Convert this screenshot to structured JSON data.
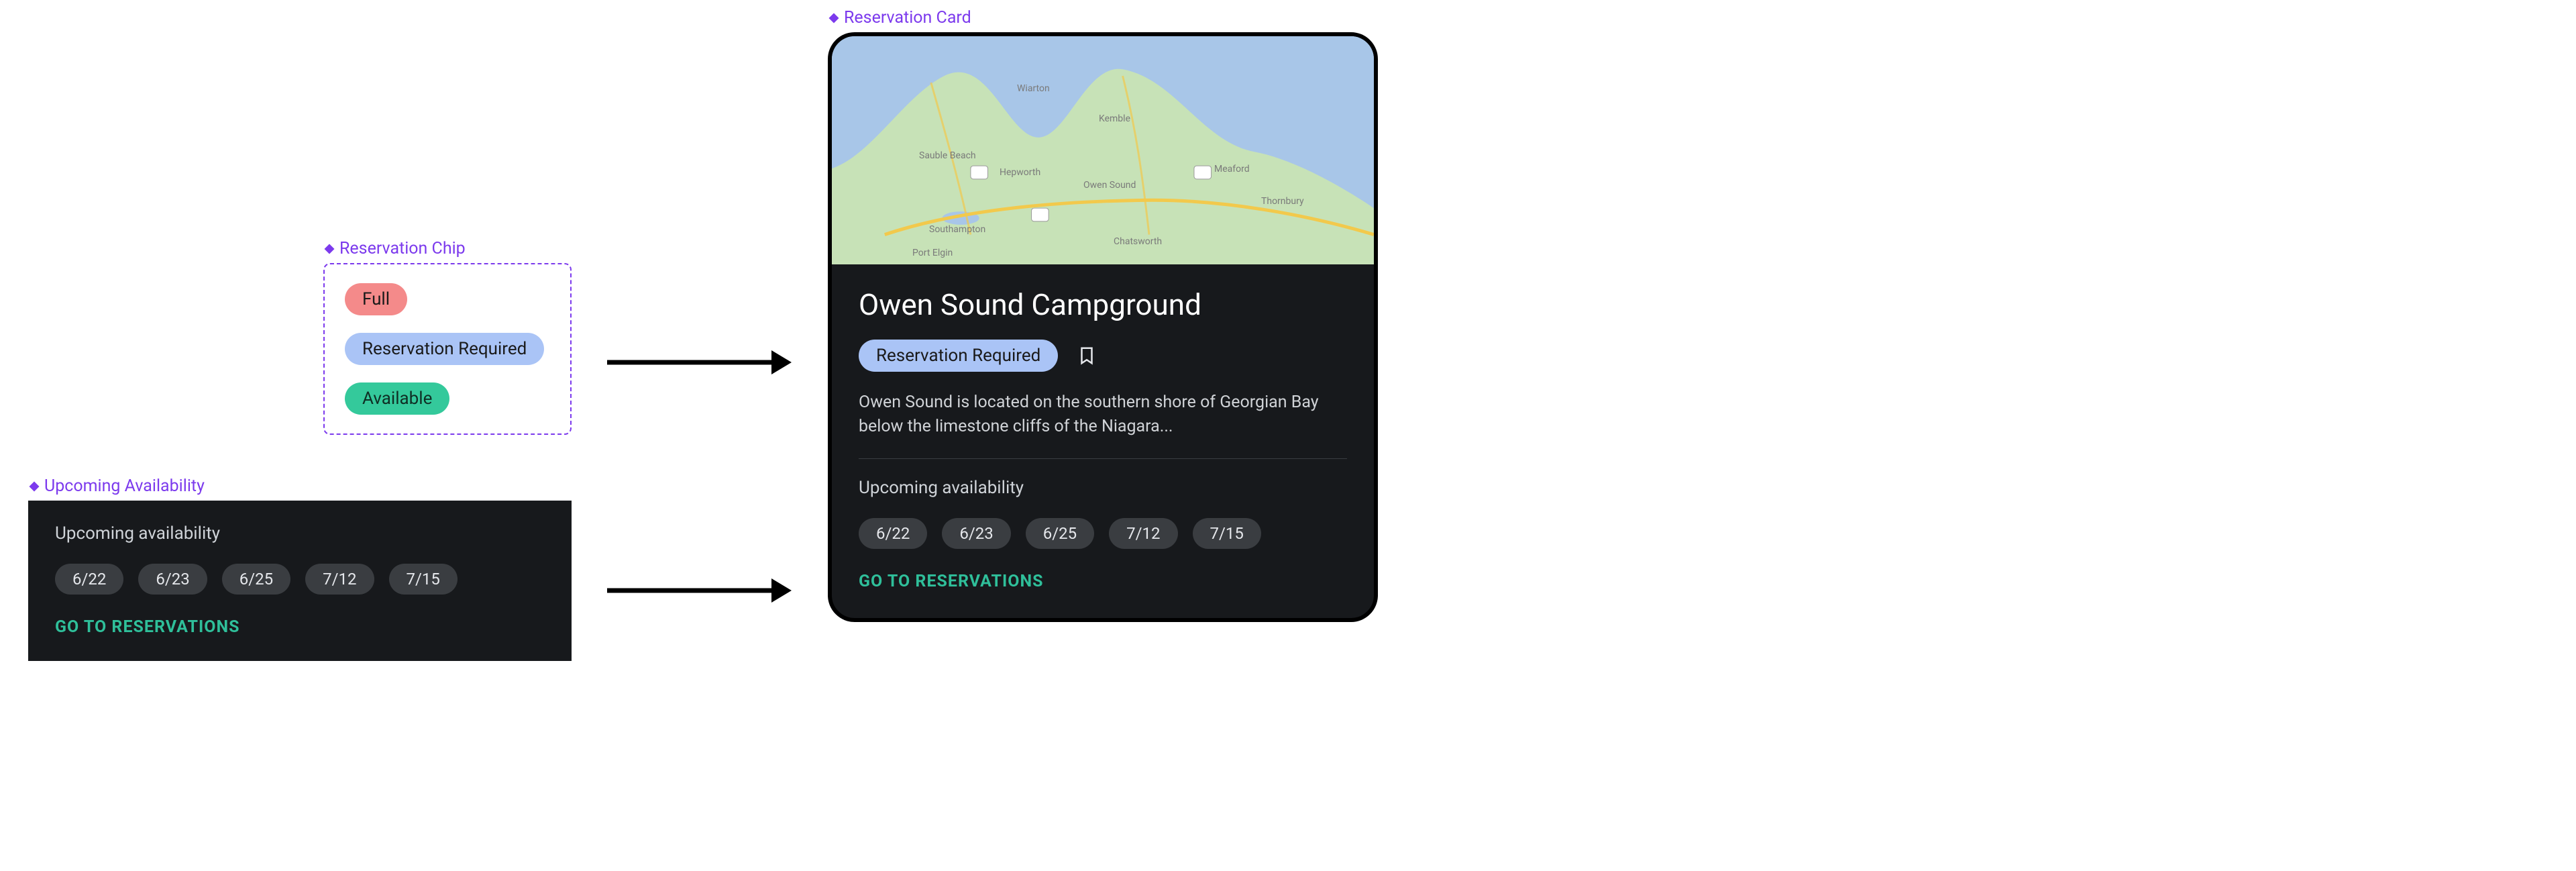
{
  "labels": {
    "reservation_chip": "Reservation Chip",
    "upcoming_availability": "Upcoming Availability",
    "reservation_card": "Reservation Card"
  },
  "chips": {
    "full": "Full",
    "reservation_required": "Reservation Required",
    "available": "Available"
  },
  "availability": {
    "heading": "Upcoming availability",
    "dates": [
      "6/22",
      "6/23",
      "6/25",
      "7/12",
      "7/15"
    ],
    "cta": "GO TO RESERVATIONS"
  },
  "card": {
    "title": "Owen Sound Campground",
    "status_chip": "Reservation Required",
    "description": "Owen Sound is located on the southern shore of Georgian Bay below the limestone cliffs of the Niagara...",
    "availability_heading": "Upcoming availability",
    "dates": [
      "6/22",
      "6/23",
      "6/25",
      "7/12",
      "7/15"
    ],
    "cta": "GO TO RESERVATIONS",
    "map_places": [
      "Wiarton",
      "Kemble",
      "Sauble Beach",
      "Hepworth",
      "Owen Sound",
      "Meaford",
      "Thornbury",
      "Southampton",
      "Port Elgin",
      "Chatsworth"
    ]
  }
}
